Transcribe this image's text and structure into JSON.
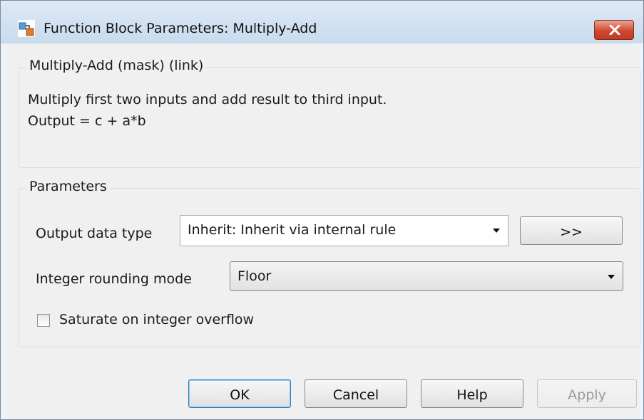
{
  "window": {
    "title": "Function Block Parameters: Multiply-Add",
    "app_icon": "simulink-block-icon",
    "close_icon": "close-icon",
    "close_color": "#c7402a"
  },
  "description_group": {
    "legend": "Multiply-Add (mask) (link)",
    "lines": [
      "Multiply first two inputs and add result to third input.",
      "Output = c + a*b"
    ]
  },
  "parameters_group": {
    "legend": "Parameters",
    "output_data_type": {
      "label": "Output data type",
      "value": "Inherit: Inherit via internal rule",
      "assistant_button": ">>"
    },
    "integer_rounding_mode": {
      "label": "Integer rounding mode",
      "value": "Floor"
    },
    "saturate": {
      "label": "Saturate on integer overflow",
      "checked": false
    }
  },
  "buttons": {
    "ok": "OK",
    "cancel": "Cancel",
    "help": "Help",
    "apply": "Apply"
  }
}
